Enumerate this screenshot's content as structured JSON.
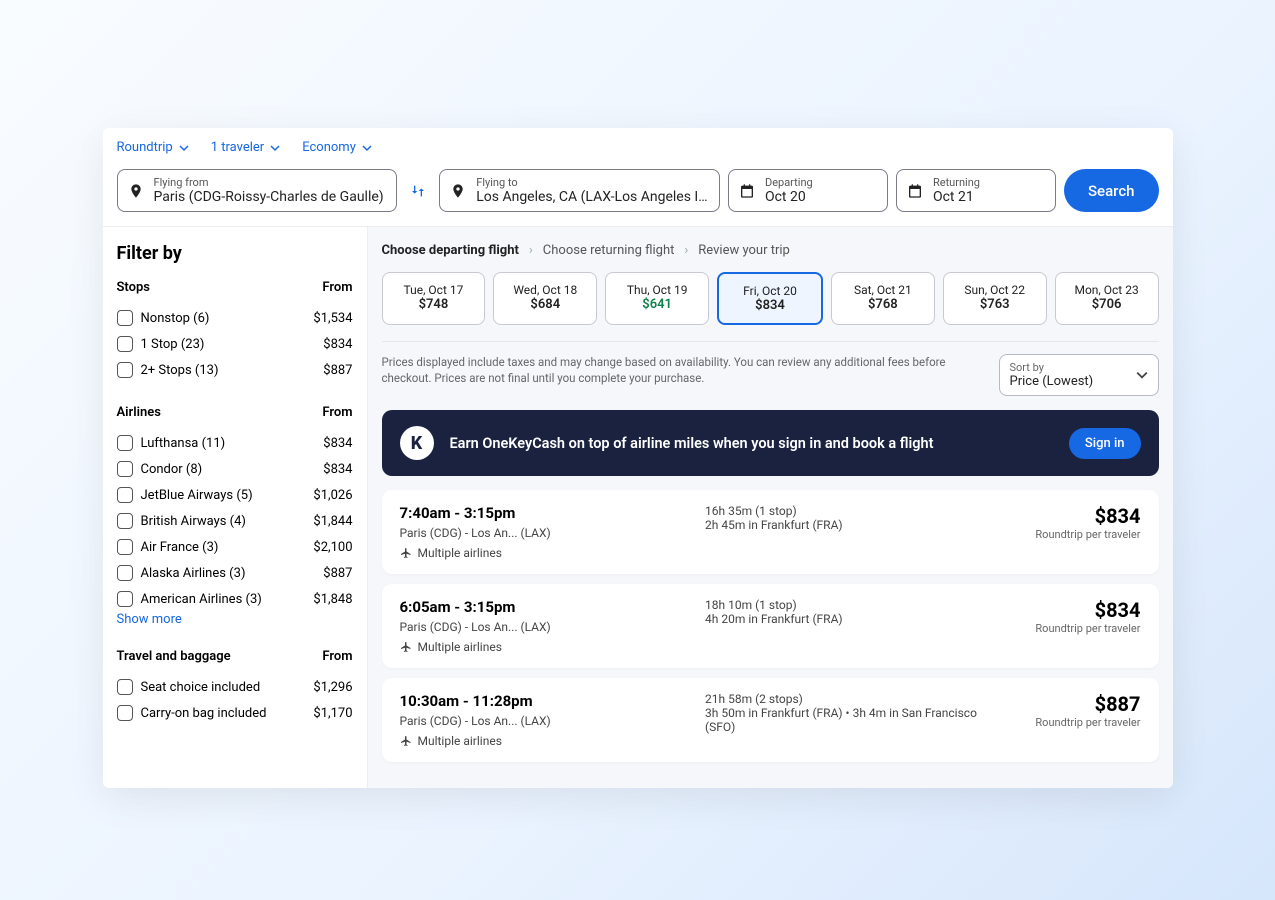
{
  "topbar": {
    "trip_type": "Roundtrip",
    "travelers": "1 traveler",
    "cabin": "Economy"
  },
  "search": {
    "from_label": "Flying from",
    "from_value": "Paris (CDG-Roissy-Charles de Gaulle)",
    "to_label": "Flying to",
    "to_value": "Los Angeles, CA (LAX-Los Angeles I...",
    "depart_label": "Departing",
    "depart_value": "Oct 20",
    "return_label": "Returning",
    "return_value": "Oct 21",
    "button": "Search"
  },
  "filter": {
    "title": "Filter by",
    "from_label": "From",
    "stops": {
      "title": "Stops",
      "items": [
        {
          "label": "Nonstop (6)",
          "price": "$1,534"
        },
        {
          "label": "1 Stop (23)",
          "price": "$834"
        },
        {
          "label": "2+ Stops (13)",
          "price": "$887"
        }
      ]
    },
    "airlines": {
      "title": "Airlines",
      "items": [
        {
          "label": "Lufthansa (11)",
          "price": "$834"
        },
        {
          "label": "Condor (8)",
          "price": "$834"
        },
        {
          "label": "JetBlue Airways (5)",
          "price": "$1,026"
        },
        {
          "label": "British Airways (4)",
          "price": "$1,844"
        },
        {
          "label": "Air France (3)",
          "price": "$2,100"
        },
        {
          "label": "Alaska Airlines (3)",
          "price": "$887"
        },
        {
          "label": "American Airlines (3)",
          "price": "$1,848"
        }
      ],
      "show_more": "Show more"
    },
    "travel": {
      "title": "Travel and baggage",
      "items": [
        {
          "label": "Seat choice included",
          "price": "$1,296"
        },
        {
          "label": "Carry-on bag included",
          "price": "$1,170"
        }
      ]
    }
  },
  "steps": {
    "s1": "Choose departing flight",
    "s2": "Choose returning flight",
    "s3": "Review your trip"
  },
  "dates": [
    {
      "d": "Tue, Oct 17",
      "p": "$748"
    },
    {
      "d": "Wed, Oct 18",
      "p": "$684"
    },
    {
      "d": "Thu, Oct 19",
      "p": "$641",
      "best": true
    },
    {
      "d": "Fri, Oct 20",
      "p": "$834",
      "selected": true
    },
    {
      "d": "Sat, Oct 21",
      "p": "$768"
    },
    {
      "d": "Sun, Oct 22",
      "p": "$763"
    },
    {
      "d": "Mon, Oct 23",
      "p": "$706"
    }
  ],
  "note": "Prices displayed include taxes and may change based on availability. You can review any additional fees before checkout. Prices are not final until you complete your purchase.",
  "sort": {
    "label": "Sort by",
    "value": "Price (Lowest)"
  },
  "banner": {
    "msg": "Earn OneKeyCash on top of airline miles when you sign in and book a flight",
    "button": "Sign in"
  },
  "flights": [
    {
      "time": "7:40am - 3:15pm",
      "route": "Paris (CDG) - Los An... (LAX)",
      "airline": "Multiple airlines",
      "dur": "16h 35m (1 stop)",
      "layover": "2h 45m in Frankfurt (FRA)",
      "price": "$834",
      "priceLabel": "Roundtrip per traveler"
    },
    {
      "time": "6:05am - 3:15pm",
      "route": "Paris (CDG) - Los An... (LAX)",
      "airline": "Multiple airlines",
      "dur": "18h 10m (1 stop)",
      "layover": "4h 20m in Frankfurt (FRA)",
      "price": "$834",
      "priceLabel": "Roundtrip per traveler"
    },
    {
      "time": "10:30am - 11:28pm",
      "route": "Paris (CDG) - Los An... (LAX)",
      "airline": "Multiple airlines",
      "dur": "21h 58m (2 stops)",
      "layover": "3h 50m in Frankfurt (FRA) • 3h 4m in San Francisco (SFO)",
      "price": "$887",
      "priceLabel": "Roundtrip per traveler"
    }
  ]
}
